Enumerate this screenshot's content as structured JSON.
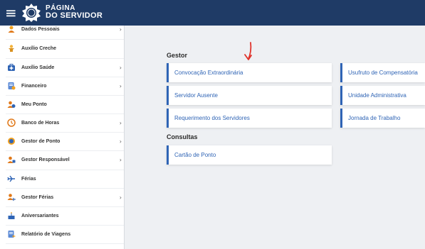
{
  "header": {
    "brand_line1": "PÁGINA",
    "brand_line2": "DO SERVIDOR"
  },
  "sidebar": {
    "items": [
      {
        "label": "Dados Pessoais",
        "icon": "person-icon",
        "has_submenu": true
      },
      {
        "label": "Auxílio Creche",
        "icon": "child-icon",
        "has_submenu": false
      },
      {
        "label": "Auxílio Saúde",
        "icon": "medical-kit-icon",
        "has_submenu": true
      },
      {
        "label": "Financeiro",
        "icon": "finance-document-icon",
        "has_submenu": true
      },
      {
        "label": "Meu Ponto",
        "icon": "user-clock-icon",
        "has_submenu": false
      },
      {
        "label": "Banco de Horas",
        "icon": "clock-icon",
        "has_submenu": true
      },
      {
        "label": "Gestor de Ponto",
        "icon": "manager-clock-icon",
        "has_submenu": true
      },
      {
        "label": "Gestor Responsável",
        "icon": "manager-icon",
        "has_submenu": true
      },
      {
        "label": "Férias",
        "icon": "airplane-icon",
        "has_submenu": false
      },
      {
        "label": "Gestor Férias",
        "icon": "manager-vacation-icon",
        "has_submenu": true
      },
      {
        "label": "Aniversariantes",
        "icon": "cake-icon",
        "has_submenu": false
      },
      {
        "label": "Relatório de Viagens",
        "icon": "travel-report-icon",
        "has_submenu": false
      }
    ],
    "chevron": "›"
  },
  "main": {
    "gestor_title": "Gestor",
    "gestor_cards_col1": [
      "Convocação Extraordinária",
      "Servidor Ausente",
      "Requerimento dos Servidores"
    ],
    "gestor_cards_col2": [
      "Usufruto de Compensatória",
      "Unidade Administrativa",
      "Jornada de Trabalho"
    ],
    "consultas_title": "Consultas",
    "consultas_cards": [
      "Cartão de Ponto"
    ]
  },
  "colors": {
    "topbar": "#1f3b66",
    "accent": "#2f64b5",
    "annotation_arrow": "#e0332b"
  }
}
